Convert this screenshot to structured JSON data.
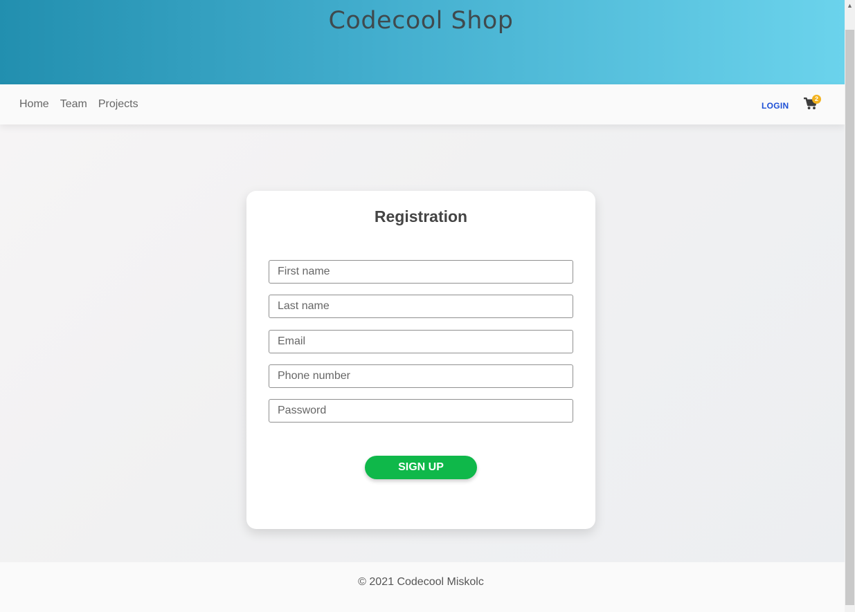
{
  "header": {
    "title": "Codecool Shop"
  },
  "nav": {
    "links": [
      "Home",
      "Team",
      "Projects"
    ],
    "login_label": "LOGIN",
    "cart_count": "2"
  },
  "form": {
    "title": "Registration",
    "fields": [
      {
        "placeholder": "First name",
        "value": ""
      },
      {
        "placeholder": "Last name",
        "value": ""
      },
      {
        "placeholder": "Email",
        "value": ""
      },
      {
        "placeholder": "Phone number",
        "value": ""
      },
      {
        "placeholder": "Password",
        "value": ""
      }
    ],
    "submit_label": "SIGN UP"
  },
  "footer": {
    "text": "© 2021 Codecool Miskolc"
  },
  "colors": {
    "accent_green": "#0fb84a",
    "login_blue": "#1c4fd6",
    "badge_yellow": "#f2b21e",
    "header_start": "#228faf",
    "header_end": "#6bd3ec"
  },
  "icons": {
    "cart": "shopping-cart-icon",
    "scroll_up": "chevron-up-icon"
  }
}
